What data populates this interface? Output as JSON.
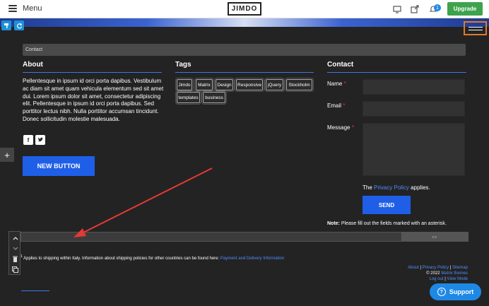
{
  "topbar": {
    "menu_label": "Menu",
    "logo": "JIMDO",
    "notification_count": "1",
    "upgrade_label": "Upgrade"
  },
  "breadcrumb": "Contact",
  "about": {
    "title": "About",
    "text": "Pellentesque in ipsum id orci porta dapibus. Vestibulum ac diam sit amet quam vehicula elementum sed sit amet dui. Lorem ipsum dolor sit amet, consectetur adipiscing elit. Pellentesque in ipsum id orci porta dapibus. Sed porttitor lectus nibh. Nulla porttitor accumsan tincidunt. Donec sollicitudin molestie malesuada.",
    "facebook": "f",
    "twitter": "t",
    "button_label": "NEW BUTTON"
  },
  "tags": {
    "title": "Tags",
    "items": [
      "Jimdo",
      "Matrix",
      "Design",
      "Responsive",
      "jQuery",
      "Stockholm",
      "templates",
      "business"
    ]
  },
  "contact": {
    "title": "Contact",
    "name_label": "Name",
    "email_label": "Email",
    "message_label": "Message",
    "required_mark": "*",
    "privacy_prefix": "The",
    "privacy_link": "Privacy Policy",
    "privacy_suffix": "applies.",
    "send_label": "SEND",
    "note_bold": "Note:",
    "note_text": "Please fill out the fields marked with an asterisk."
  },
  "shipping": {
    "marker": "1",
    "text": "Applies to shipping within Italy. Information about shipping policies for other countries can be found here:",
    "link": "Payment and Delivery Information"
  },
  "footer": {
    "about": "About",
    "privacy": "Privacy Policy",
    "sitemap": "Sitemap",
    "copyright": "© 2022",
    "theme_link": "Matrix themes",
    "logout": "Log out",
    "view_mode": "View Mode",
    "sep": "|"
  },
  "support_label": "Support",
  "colors": {
    "accent": "#1f5fe8",
    "upgrade": "#3fa34d",
    "highlight": "#e07a2a",
    "background": "#232323"
  }
}
